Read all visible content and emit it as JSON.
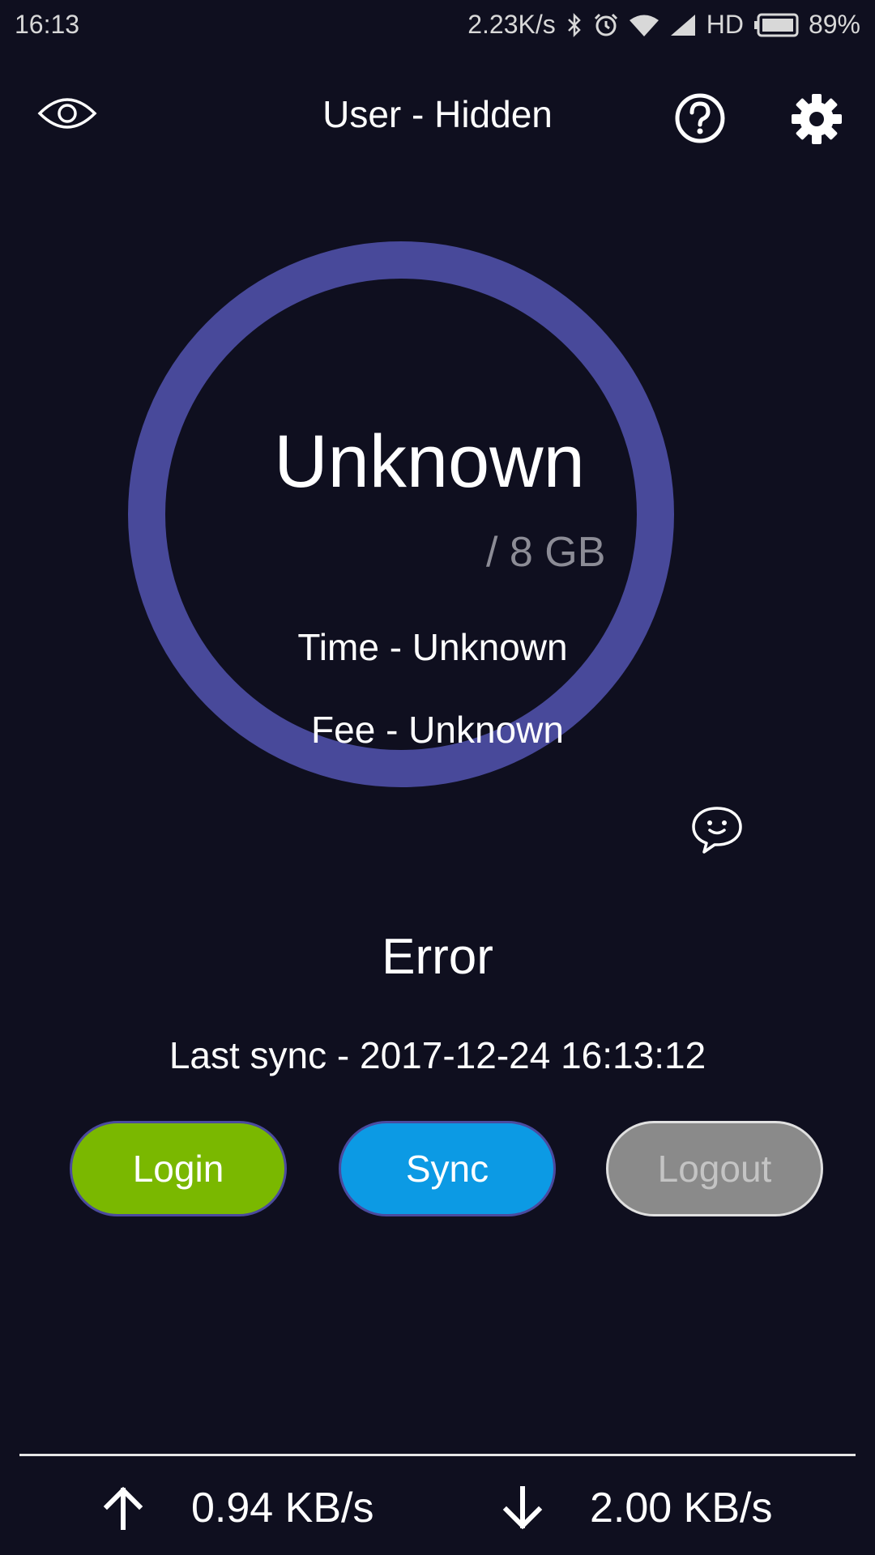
{
  "status_bar": {
    "time": "16:13",
    "net_speed": "2.23K/s",
    "network_type": "HD",
    "battery": "89%",
    "icons": [
      "bluetooth-icon",
      "alarm-icon",
      "wifi-icon",
      "signal-icon",
      "battery-icon"
    ]
  },
  "header": {
    "title": "User - Hidden",
    "icons": [
      "eye-icon",
      "help-icon",
      "gear-icon"
    ]
  },
  "usage": {
    "value": "Unknown",
    "quota": "/ 8 GB",
    "time": "Time - Unknown",
    "fee": "Fee - Unknown",
    "ring_color": "#48499a"
  },
  "state": {
    "status": "Error",
    "last_sync": "Last sync - 2017-12-24 16:13:12"
  },
  "buttons": {
    "login": "Login",
    "sync": "Sync",
    "logout": "Logout",
    "login_color": "#7ab800",
    "sync_color": "#0c9ae4",
    "logout_color": "#8a8a8a"
  },
  "speeds": {
    "upload": "0.94 KB/s",
    "download": "2.00 KB/s"
  }
}
